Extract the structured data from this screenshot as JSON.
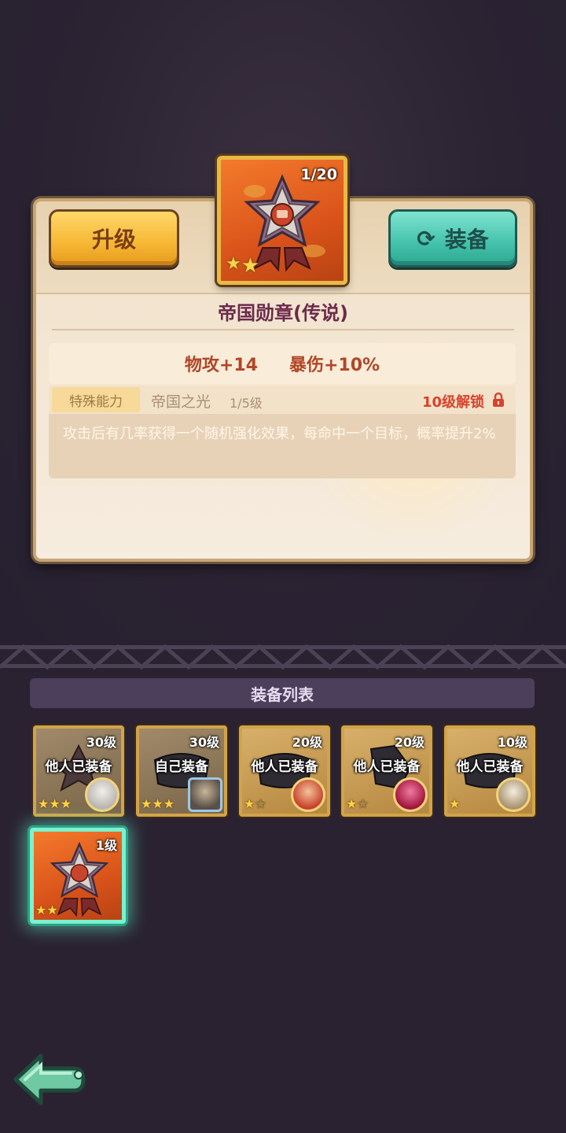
{
  "item": {
    "name": "帝国勋章(传说)",
    "count": "1/20",
    "stars": 2
  },
  "buttons": {
    "upgrade": "升级",
    "equip": "装备"
  },
  "stats": {
    "attack": "物攻+14",
    "crit_damage": "暴伤+10%"
  },
  "ability": {
    "tag": "特殊能力",
    "name": "帝国之光",
    "level": "1/5级",
    "unlock": "10级解锁",
    "description": "攻击后有几率获得一个随机强化效果，每命中一个目标，概率提升2%"
  },
  "list": {
    "title": "装备列表",
    "items": [
      {
        "level": "30级",
        "status": "他人已装备",
        "stars": 3
      },
      {
        "level": "30级",
        "status": "自己装备",
        "stars": 3
      },
      {
        "level": "20级",
        "status": "他人已装备",
        "stars": 2
      },
      {
        "level": "20级",
        "status": "他人已装备",
        "stars": 2
      },
      {
        "level": "10级",
        "status": "他人已装备",
        "stars": 1
      },
      {
        "level": "1级",
        "status": "",
        "stars": 2,
        "selected": true
      }
    ]
  },
  "colors": {
    "background": "#2a2231",
    "upgrade_button": "#f6b733",
    "equip_button": "#43c2ab",
    "item_name": "#6c2a4a",
    "stat_text": "#b04727",
    "unlock_text": "#d8432c",
    "selected_glow": "#7bf2cf"
  },
  "icons": {
    "equip_button": "refresh-icon",
    "unlock": "lock-icon",
    "back": "back-arrow-icon"
  }
}
